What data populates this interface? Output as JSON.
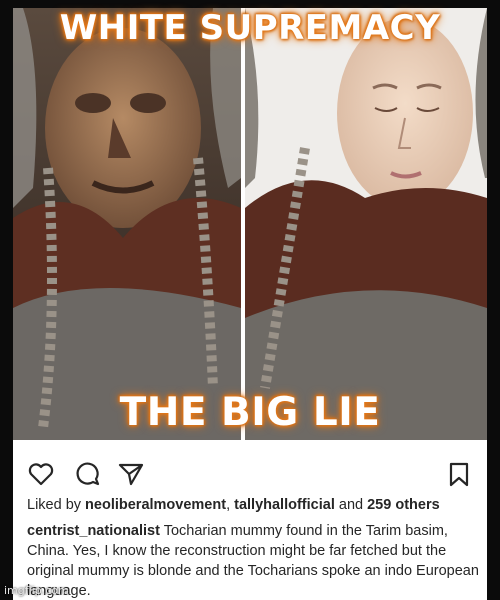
{
  "meme": {
    "top_text": "WHITE SUPREMACY",
    "bottom_text": "THE BIG LIE",
    "glow_color": "#e67a1a"
  },
  "post": {
    "icons": [
      "heart-icon",
      "comment-icon",
      "share-icon",
      "bookmark-icon"
    ],
    "liked": {
      "prefix": "Liked by ",
      "user1": "neoliberalmovement",
      "sep": ", ",
      "user2": "tallyhallofficial",
      "and": " and ",
      "others": "259 others"
    },
    "caption": {
      "username": "centrist_nationalist",
      "text": " Tocharian mummy found in the Tarim basim, China. Yes, I know the reconstruction might be far fetched but the original mummy is blonde and the Tocharians spoke an indo European language."
    }
  },
  "watermark": "imgflip.com"
}
